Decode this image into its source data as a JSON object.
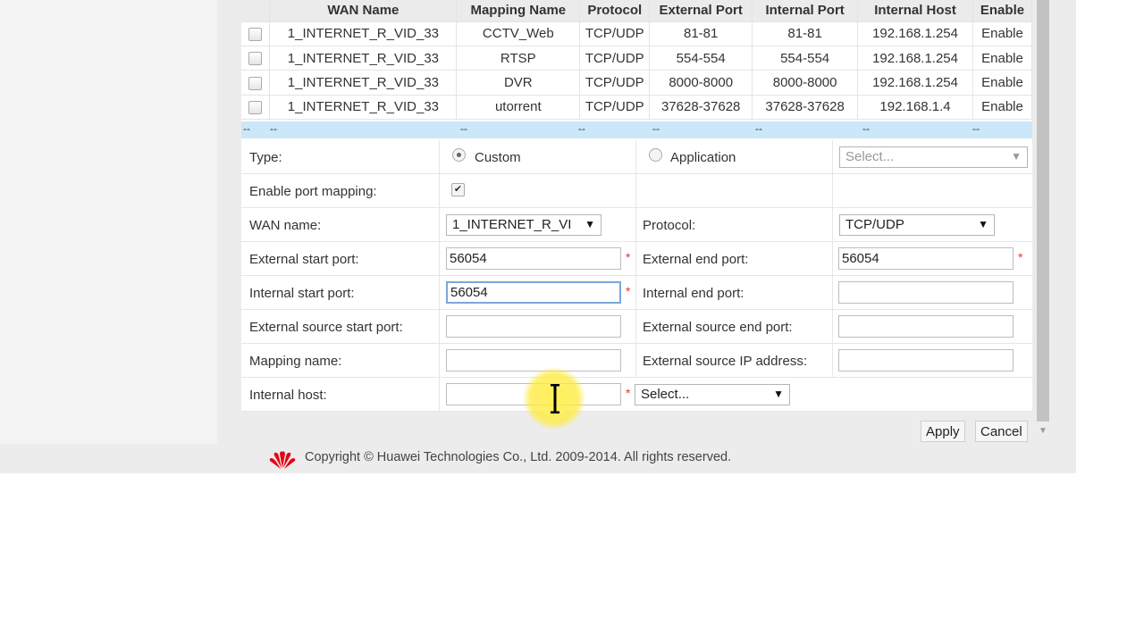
{
  "table": {
    "headers": [
      "",
      "WAN Name",
      "Mapping Name",
      "Protocol",
      "External Port",
      "Internal Port",
      "Internal Host",
      "Enable"
    ],
    "rows": [
      [
        "1_INTERNET_R_VID_33",
        "CCTV_Web",
        "TCP/UDP",
        "81-81",
        "81-81",
        "192.168.1.254",
        "Enable"
      ],
      [
        "1_INTERNET_R_VID_33",
        "RTSP",
        "TCP/UDP",
        "554-554",
        "554-554",
        "192.168.1.254",
        "Enable"
      ],
      [
        "1_INTERNET_R_VID_33",
        "DVR",
        "TCP/UDP",
        "8000-8000",
        "8000-8000",
        "192.168.1.254",
        "Enable"
      ],
      [
        "1_INTERNET_R_VID_33",
        "utorrent",
        "TCP/UDP",
        "37628-37628",
        "37628-37628",
        "192.168.1.4",
        "Enable"
      ]
    ],
    "new_row_placeholder": "--"
  },
  "form": {
    "type_label": "Type:",
    "type_custom": "Custom",
    "type_application": "Application",
    "app_select": "Select...",
    "enable_label": "Enable port mapping:",
    "wan_label": "WAN name:",
    "wan_value": "1_INTERNET_R_VI",
    "protocol_label": "Protocol:",
    "protocol_value": "TCP/UDP",
    "ext_start_label": "External start port:",
    "ext_start_value": "56054",
    "ext_end_label": "External end port:",
    "ext_end_value": "56054",
    "int_start_label": "Internal start port:",
    "int_start_value": "56054",
    "int_end_label": "Internal end port:",
    "int_end_value": "",
    "src_start_label": "External source start port:",
    "src_end_label": "External source end port:",
    "mapping_name_label": "Mapping name:",
    "src_ip_label": "External source IP address:",
    "internal_host_label": "Internal host:",
    "host_select": "Select...",
    "required_mark": "*"
  },
  "buttons": {
    "apply": "Apply",
    "cancel": "Cancel"
  },
  "footer": {
    "copyright": "Copyright © Huawei Technologies Co., Ltd. 2009-2014. All rights reserved."
  },
  "colors": {
    "selected_row": "#cce6fa",
    "brand_red": "#e60012"
  }
}
